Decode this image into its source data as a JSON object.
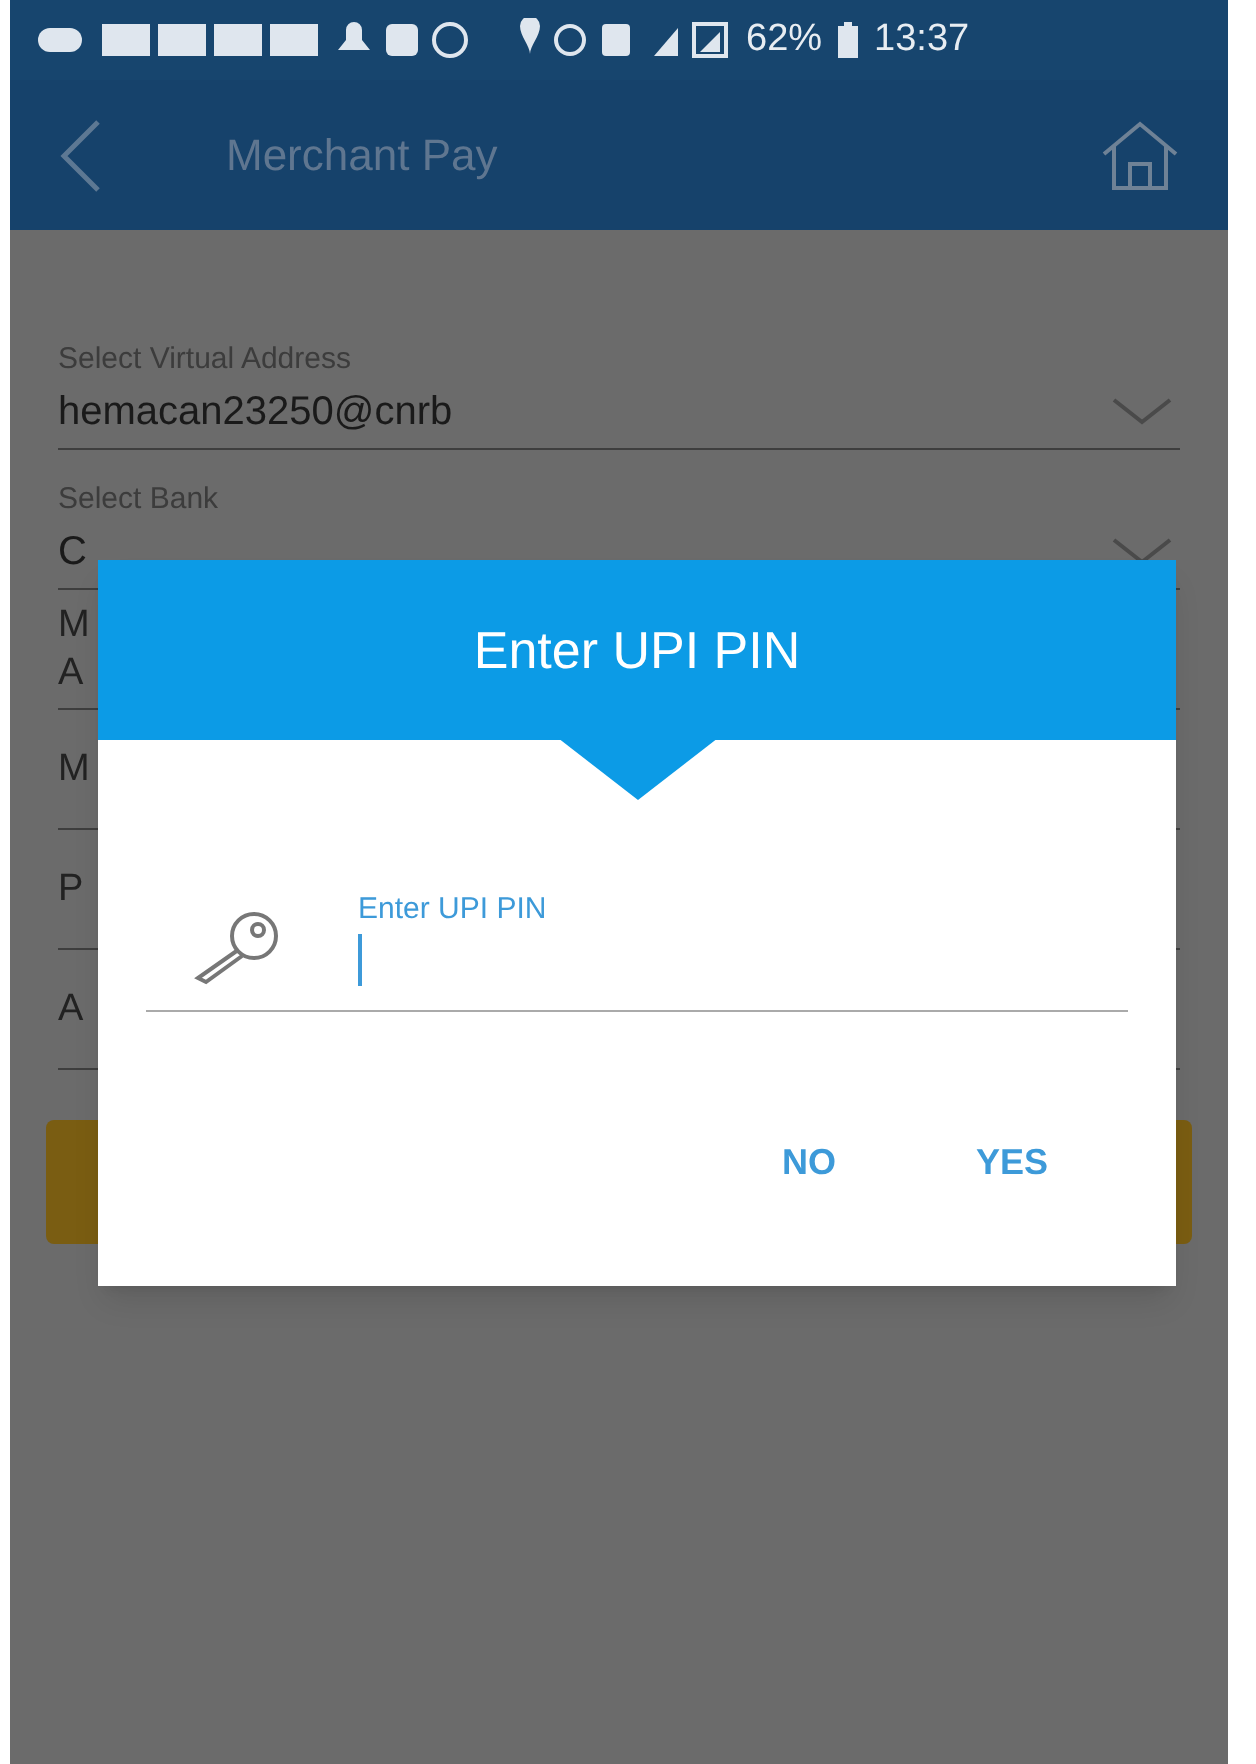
{
  "status_bar": {
    "battery": "62%",
    "time": "13:37"
  },
  "app_bar": {
    "title": "Merchant Pay"
  },
  "fields": [
    {
      "kind": "dropdown",
      "label": "Select Virtual Address",
      "value": "hemacan23250@cnrb"
    },
    {
      "kind": "dropdown",
      "label": "Select Bank",
      "value": "C"
    },
    {
      "kind": "covered",
      "lines": [
        "M",
        "A"
      ]
    },
    {
      "kind": "covered",
      "lines": [
        "M"
      ]
    },
    {
      "kind": "covered",
      "lines": [
        "P"
      ]
    },
    {
      "kind": "covered",
      "lines": [
        "A"
      ]
    }
  ],
  "dialog": {
    "title": "Enter UPI PIN",
    "pin_field": {
      "label": "Enter UPI PIN"
    },
    "buttons": [
      "NO",
      "YES"
    ]
  }
}
